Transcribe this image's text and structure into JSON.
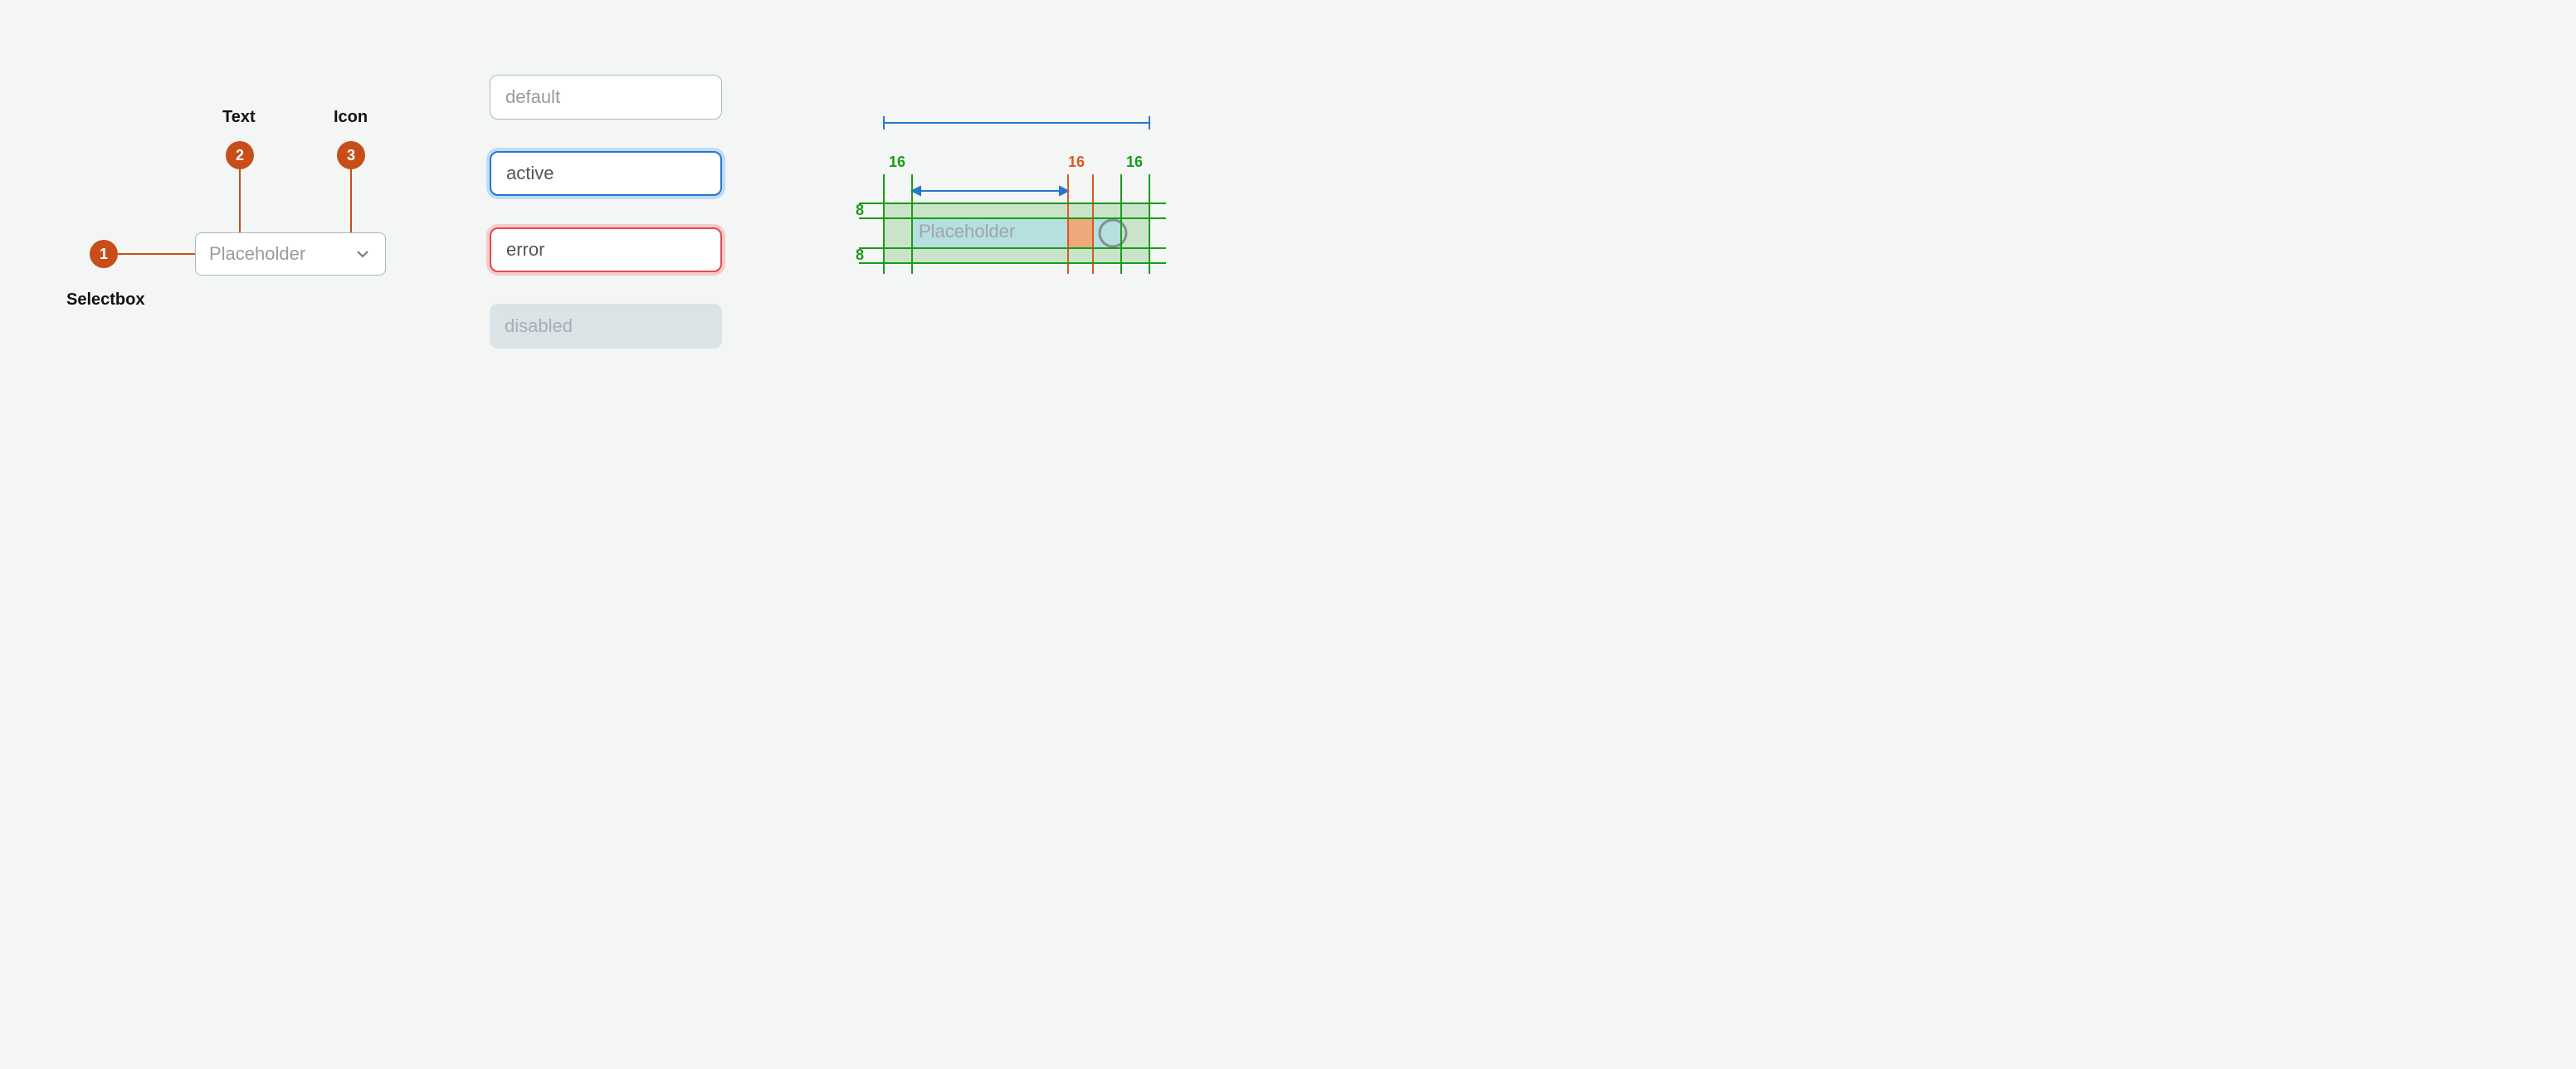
{
  "anatomy": {
    "badges": {
      "b1": {
        "num": "1",
        "label": "Selectbox"
      },
      "b2": {
        "num": "2",
        "label": "Text"
      },
      "b3": {
        "num": "3",
        "label": "Icon"
      }
    },
    "placeholder": "Placeholder"
  },
  "states": {
    "default_label": "default",
    "active_label": "active",
    "error_label": "error",
    "disabled_label": "disabled"
  },
  "spec": {
    "placeholder": "Placeholder",
    "pad_left": "16",
    "pad_mid": "16",
    "pad_right": "16",
    "pad_top": "8",
    "pad_bottom": "8"
  }
}
